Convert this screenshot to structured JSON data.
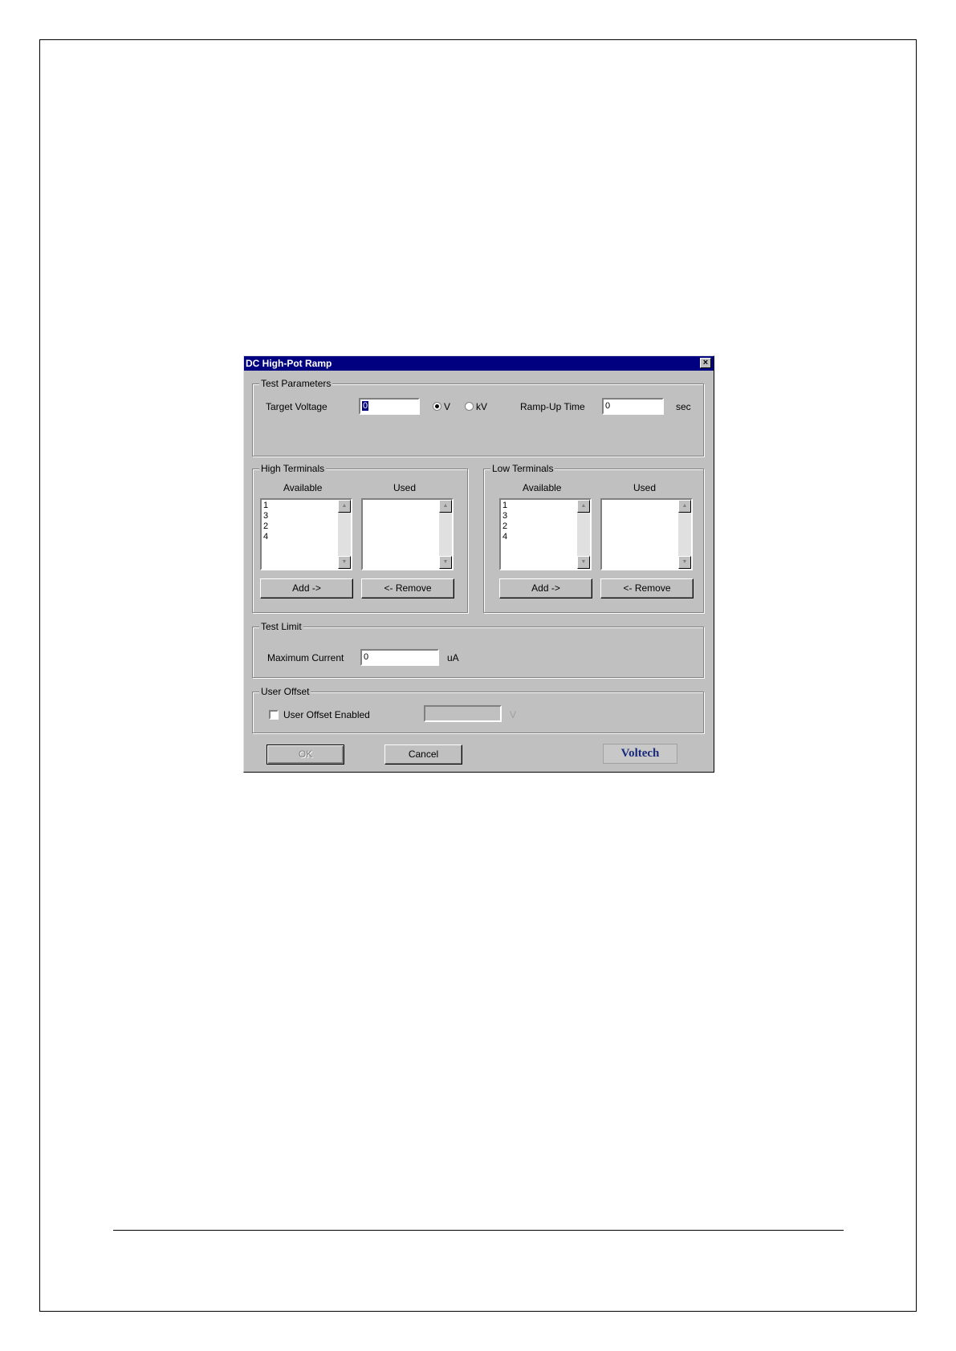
{
  "dialog": {
    "title": "DC High-Pot Ramp",
    "close_glyph": "×"
  },
  "test_parameters": {
    "legend": "Test Parameters",
    "target_voltage_label": "Target Voltage",
    "target_voltage_value": "0",
    "unit_v_label": "V",
    "unit_kv_label": "kV",
    "selected_unit": "V",
    "ramp_up_label": "Ramp-Up Time",
    "ramp_up_value": "0",
    "ramp_up_unit": "sec"
  },
  "high_terminals": {
    "legend": "High Terminals",
    "available_label": "Available",
    "used_label": "Used",
    "available_items": [
      "1",
      "3",
      "2",
      "4"
    ],
    "used_items": [],
    "add_label": "Add ->",
    "remove_label": "<- Remove"
  },
  "low_terminals": {
    "legend": "Low Terminals",
    "available_label": "Available",
    "used_label": "Used",
    "available_items": [
      "1",
      "3",
      "2",
      "4"
    ],
    "used_items": [],
    "add_label": "Add ->",
    "remove_label": "<- Remove"
  },
  "test_limit": {
    "legend": "Test Limit",
    "max_current_label": "Maximum Current",
    "max_current_value": "0",
    "unit": "uA"
  },
  "user_offset": {
    "legend": "User Offset",
    "enabled_label": "User Offset Enabled",
    "enabled": false,
    "value": "",
    "unit": "V"
  },
  "buttons": {
    "ok_label": "OK",
    "cancel_label": "Cancel"
  },
  "logo_text": "Voltech",
  "colors": {
    "titlebar": "#000080",
    "dialog_face": "#c0c0c0"
  }
}
